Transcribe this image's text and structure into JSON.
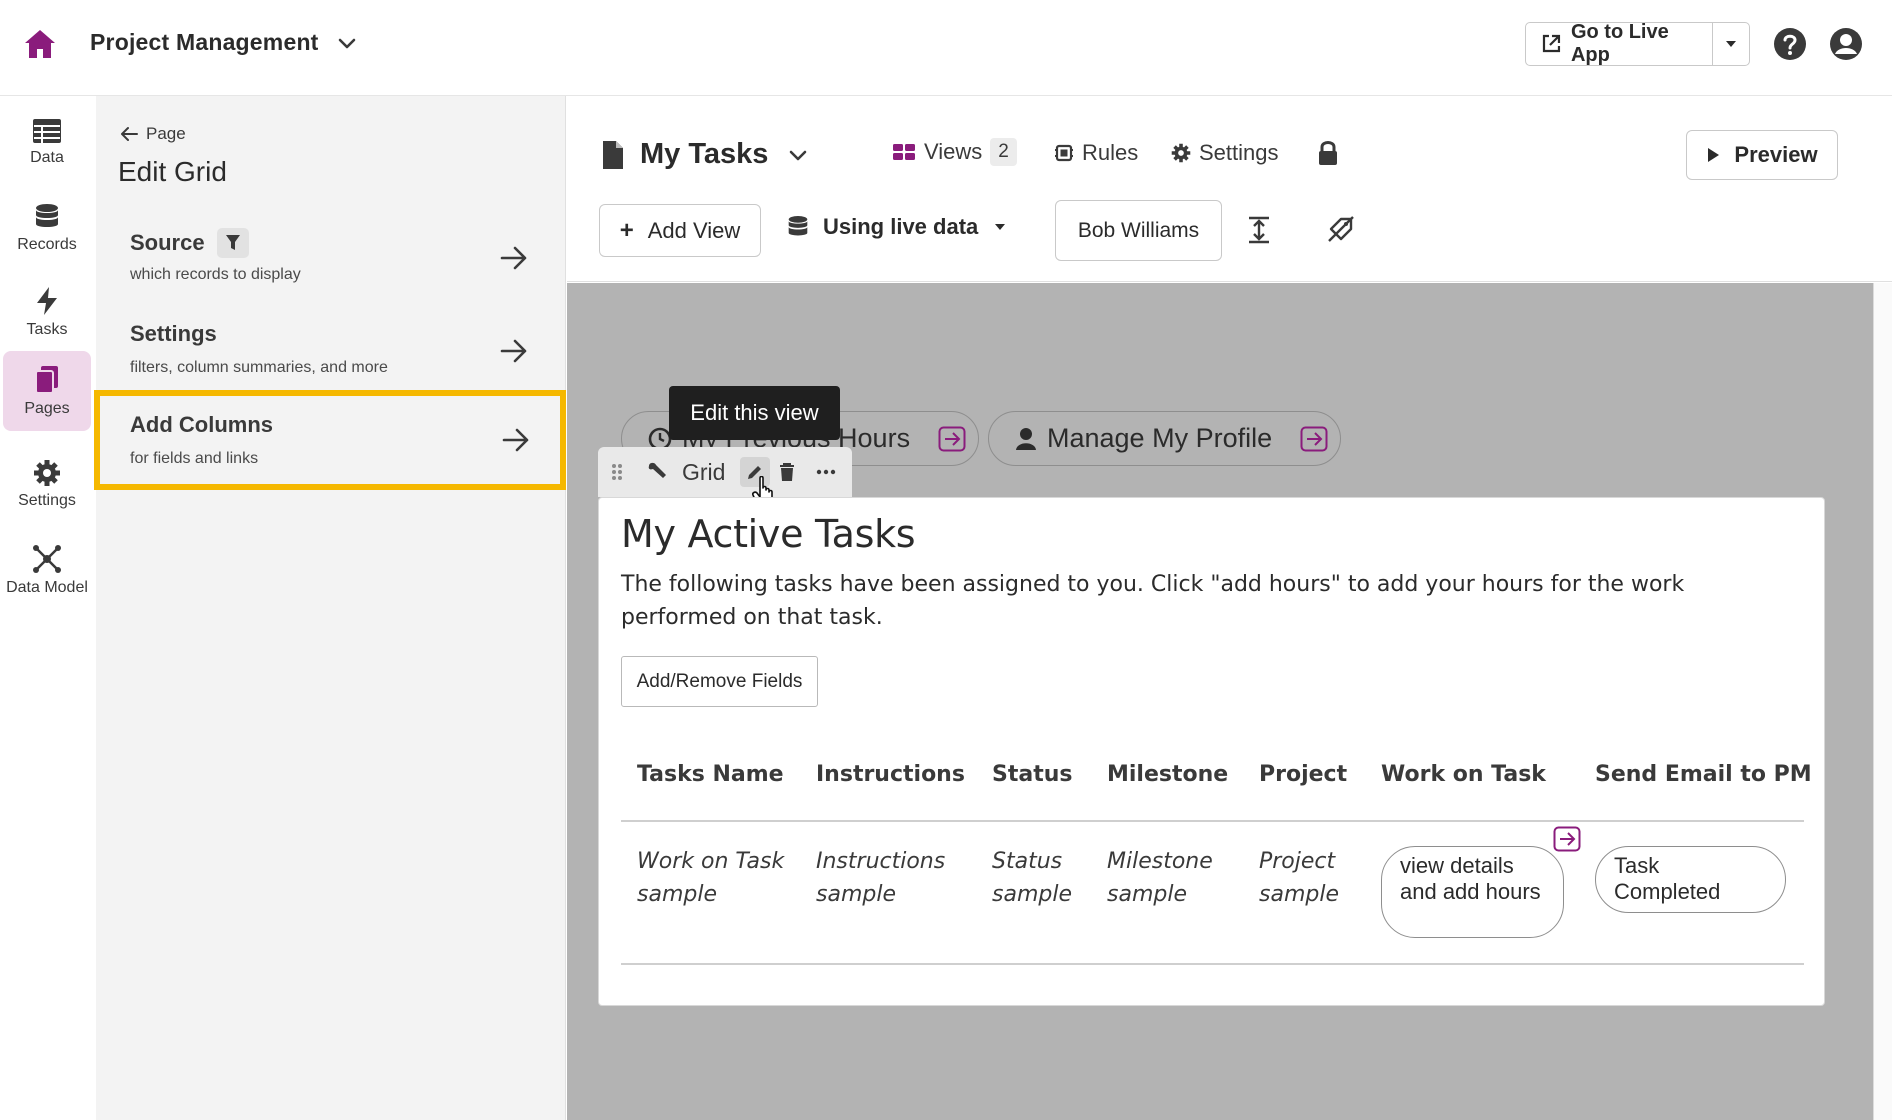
{
  "header": {
    "app_title": "Project Management",
    "live_app_label": "Go to Live App"
  },
  "rail": {
    "items": [
      {
        "label": "Data",
        "icon": "table-icon"
      },
      {
        "label": "Records",
        "icon": "database-icon"
      },
      {
        "label": "Tasks",
        "icon": "lightning-icon"
      },
      {
        "label": "Pages",
        "icon": "pages-icon",
        "active": true
      },
      {
        "label": "Settings",
        "icon": "gear-icon"
      },
      {
        "label": "Data Model",
        "icon": "network-icon"
      }
    ]
  },
  "panel": {
    "back_label": "Page",
    "title": "Edit Grid",
    "items": [
      {
        "title": "Source",
        "subtitle": "which records to display"
      },
      {
        "title": "Settings",
        "subtitle": "filters, column summaries, and more"
      },
      {
        "title": "Add Columns",
        "subtitle": "for fields and links",
        "highlighted": true
      }
    ]
  },
  "page_header": {
    "page_name": "My Tasks",
    "views_label": "Views",
    "views_count": "2",
    "rules_label": "Rules",
    "settings_label": "Settings",
    "preview_label": "Preview",
    "add_view_label": "Add View",
    "data_mode": "Using live data",
    "user_selected": "Bob Williams"
  },
  "canvas": {
    "menu_links": [
      {
        "label": "My Previous Hours",
        "icon": "clock-icon"
      },
      {
        "label": "Manage My Profile",
        "icon": "user-icon"
      }
    ],
    "tooltip": "Edit this view",
    "view_toolbar": {
      "view_type": "Grid"
    },
    "view": {
      "title": "My Active Tasks",
      "description": "The following tasks have been assigned to you. Click \"add hours\" to add your hours for the work performed on that task.",
      "fields_button": "Add/Remove Fields",
      "columns": [
        "Tasks Name",
        "Instructions",
        "Status",
        "Milestone",
        "Project",
        "Work on Task",
        "Send Email to PM"
      ],
      "row": {
        "tasks_name": "Work on Task sample",
        "instructions": "Instructions sample",
        "status": "Status sample",
        "milestone": "Milestone sample",
        "project": "Project sample",
        "work_on_task": "view details and add hours",
        "send_email": "Task Completed"
      }
    }
  },
  "colors": {
    "brand": "#8a1c7c",
    "highlight": "#f5b800",
    "canvas_bg": "#b3b3b3",
    "active_nav_bg": "#efd8ea"
  }
}
